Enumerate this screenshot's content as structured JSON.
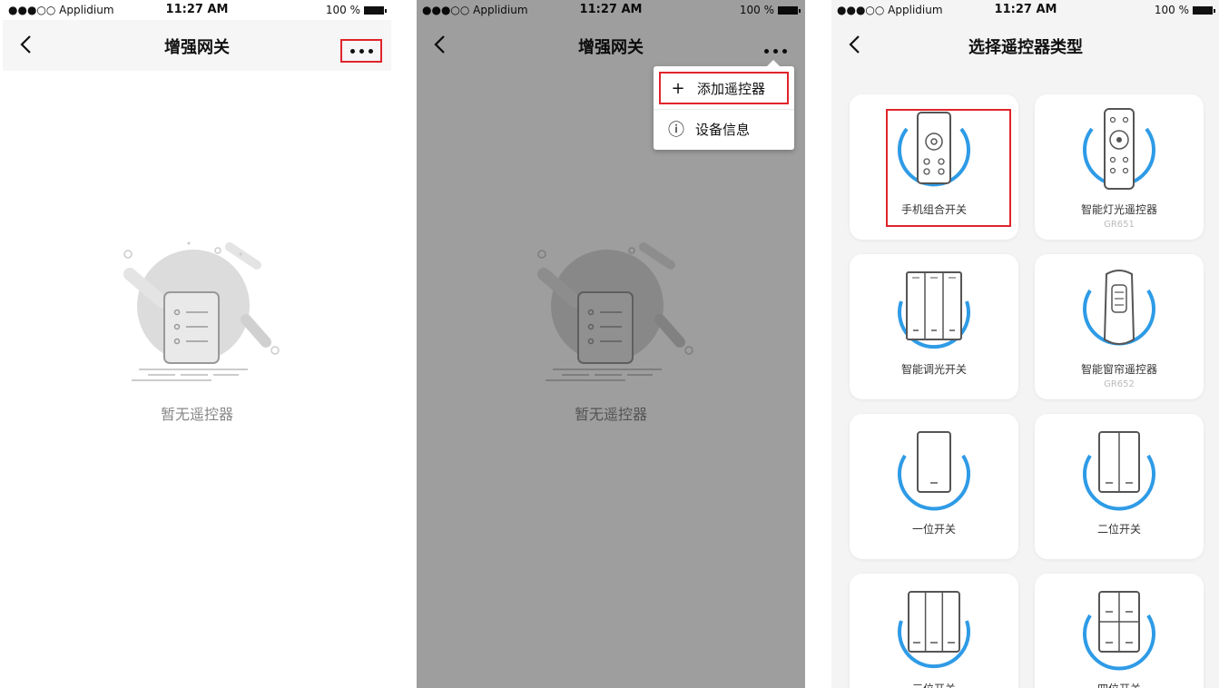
{
  "status_bar": {
    "carrier": "●●●○○ Applidium",
    "wifi": "wifi-icon",
    "time": "11:27 AM",
    "battery": "100 %"
  },
  "screen_gateway": {
    "title": "增强网关",
    "back_icon": "chevron-left-icon",
    "more_icon": "more-dots-icon",
    "empty_text": "暂无遥控器"
  },
  "menu": {
    "items": [
      {
        "icon": "+",
        "label": "添加遥控器"
      },
      {
        "icon": "ⓘ",
        "label": "设备信息"
      }
    ]
  },
  "screen_select": {
    "title": "选择遥控器类型",
    "cards": [
      {
        "name": "手机组合开关",
        "model": ""
      },
      {
        "name": "智能灯光遥控器",
        "model": "GR651"
      },
      {
        "name": "智能调光开关",
        "model": ""
      },
      {
        "name": "智能窗帘遥控器",
        "model": "GR652"
      },
      {
        "name": "一位开关",
        "model": ""
      },
      {
        "name": "二位开关",
        "model": ""
      },
      {
        "name": "三位开关",
        "model": ""
      },
      {
        "name": "四位开关",
        "model": ""
      }
    ]
  },
  "colors": {
    "accent_blue": "#2e9be6",
    "highlight_red": "#e0242b",
    "empty_gray": "#d9d9d9"
  }
}
